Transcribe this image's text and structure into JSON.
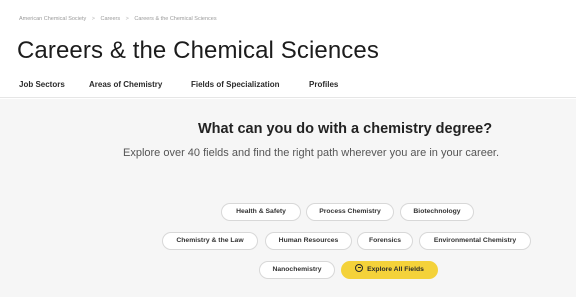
{
  "breadcrumb": {
    "items": [
      "American Chemical Society",
      "Careers",
      "Careers & the Chemical Sciences"
    ],
    "separator": ">"
  },
  "page": {
    "title": "Careers & the Chemical Sciences"
  },
  "tabs": [
    "Job Sectors",
    "Areas of Chemistry",
    "Fields of Specialization",
    "Profiles"
  ],
  "hero": {
    "heading": "What can you do with a chemistry degree?",
    "subheading": "Explore over 40 fields and find the right path wherever you are in your career."
  },
  "fields": {
    "row1": [
      "Health & Safety",
      "Process Chemistry",
      "Biotechnology"
    ],
    "row2": [
      "Chemistry & the Law",
      "Human Resources",
      "Forensics",
      "Environmental Chemistry"
    ],
    "row3": [
      "Nanochemistry"
    ],
    "cta_label": "Explore All Fields",
    "cta_icon": "circle-arrow-icon"
  },
  "colors": {
    "accent": "#f4d23a",
    "background_light": "#f6f6f6"
  }
}
